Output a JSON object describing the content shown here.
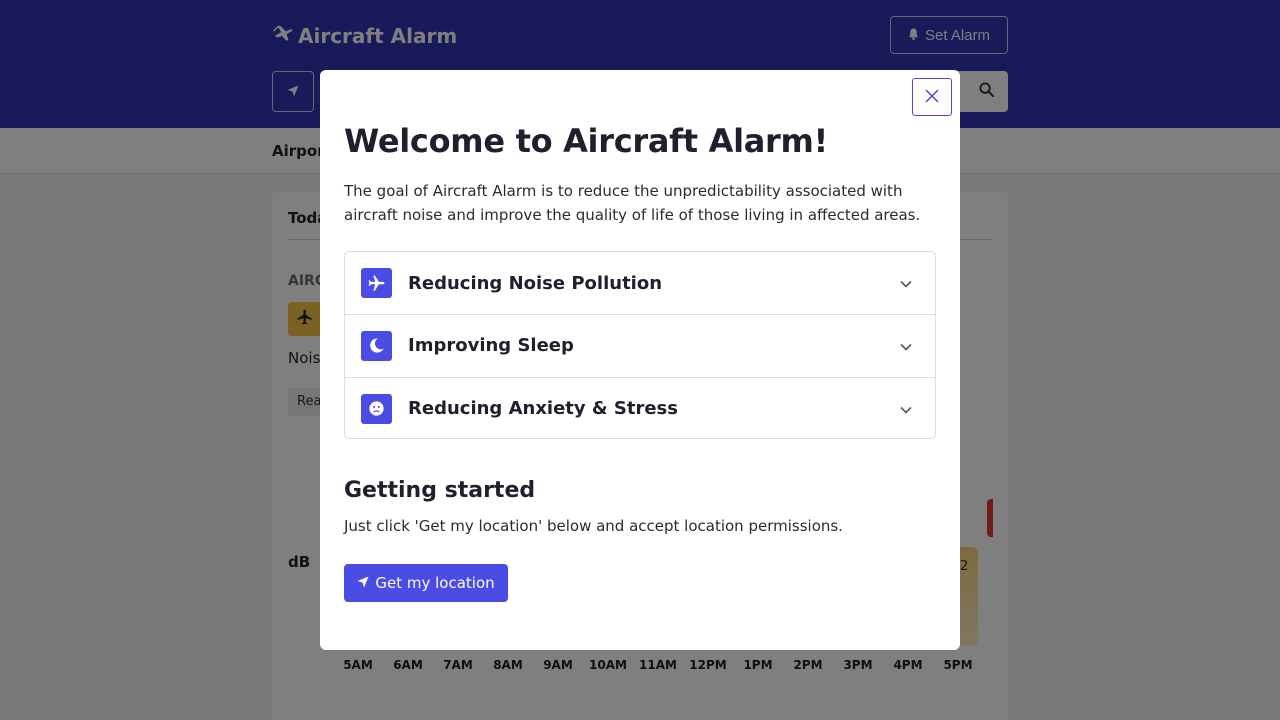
{
  "colors": {
    "header_bg": "#3334b4",
    "accent": "#4b4be6",
    "badge_yellow": "#f5c547",
    "alert_red": "#e53935"
  },
  "header": {
    "brand": "Aircraft Alarm",
    "set_alarm_label": "Set Alarm",
    "brand_icon": "plane-signal-icon",
    "set_alarm_icon": "bell-icon",
    "location_icon": "location-arrow-icon",
    "search_icon": "search-icon"
  },
  "subnav": {
    "text": "Airpor"
  },
  "background_card": {
    "tab_label": "Toda",
    "section_label": "AIRC",
    "noise_text": "Nois",
    "chip_label": "Rea",
    "db_label": "dB",
    "bar_value": "2",
    "hours": [
      "5AM",
      "6AM",
      "7AM",
      "8AM",
      "9AM",
      "10AM",
      "11AM",
      "12PM",
      "1PM",
      "2PM",
      "3PM",
      "4PM",
      "5PM"
    ]
  },
  "modal": {
    "title": "Welcome to Aircraft Alarm!",
    "intro": "The goal of Aircraft Alarm is to reduce the unpredictability associated with aircraft noise and improve the quality of life of those living in affected areas.",
    "accordion": [
      {
        "label": "Reducing Noise Pollution",
        "icon": "plane-icon",
        "expanded": false
      },
      {
        "label": "Improving Sleep",
        "icon": "moon-icon",
        "expanded": false
      },
      {
        "label": "Reducing Anxiety & Stress",
        "icon": "sad-face-icon",
        "expanded": false
      }
    ],
    "getting_started_title": "Getting started",
    "getting_started_text": "Just click 'Get my location' below and accept location permissions.",
    "get_location_label": "Get my location",
    "close_icon": "close-icon"
  }
}
